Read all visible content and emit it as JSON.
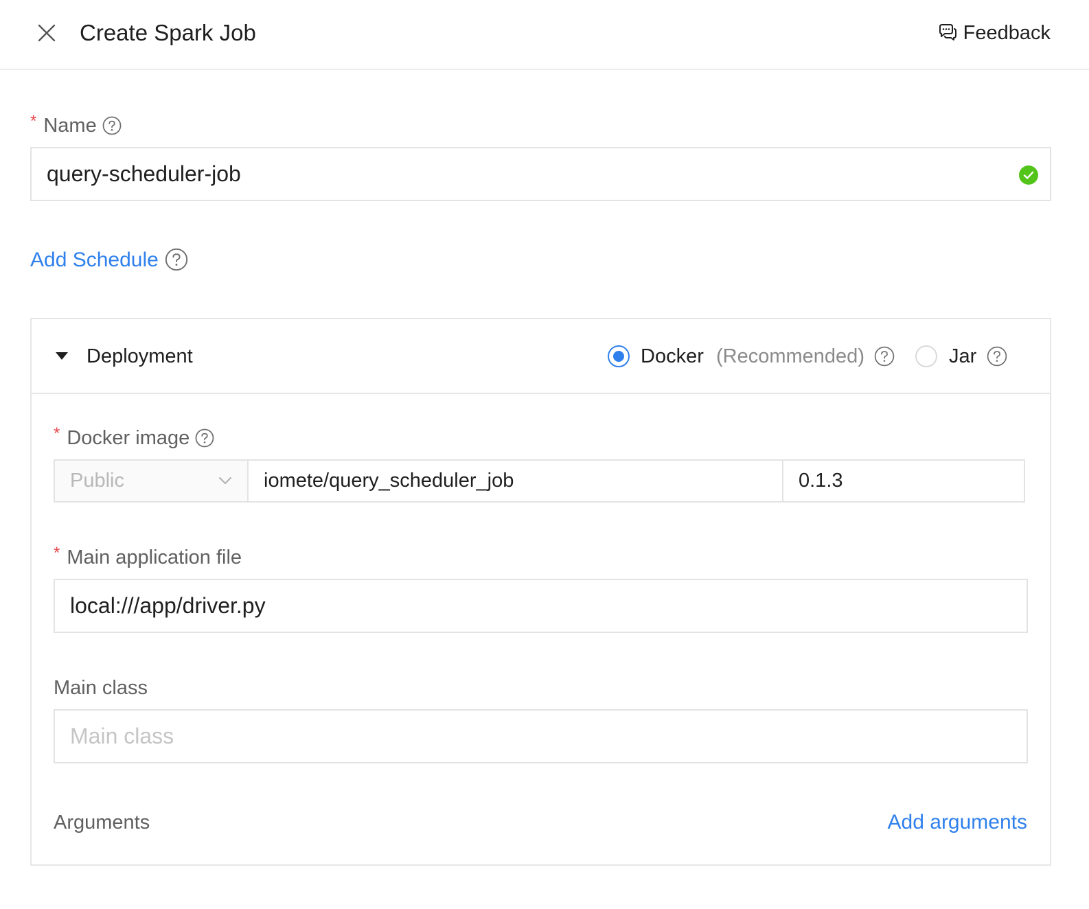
{
  "header": {
    "title": "Create Spark Job",
    "feedback_label": "Feedback"
  },
  "name_field": {
    "label": "Name",
    "value": "query-scheduler-job"
  },
  "add_schedule_label": "Add Schedule",
  "deployment": {
    "title": "Deployment",
    "options": {
      "docker": {
        "label": "Docker",
        "note": "(Recommended)",
        "selected": true
      },
      "jar": {
        "label": "Jar",
        "selected": false
      }
    },
    "docker_image": {
      "label": "Docker image",
      "registry": "Public",
      "image": "iomete/query_scheduler_job",
      "tag": "0.1.3"
    },
    "main_application_file": {
      "label": "Main application file",
      "value": "local:///app/driver.py"
    },
    "main_class": {
      "label": "Main class",
      "placeholder": "Main class"
    },
    "arguments": {
      "label": "Arguments",
      "add_label": "Add arguments"
    }
  },
  "colors": {
    "accent": "#2f80ed",
    "required": "#e5484d",
    "valid": "#52c41a",
    "border": "#e3e3e3"
  }
}
